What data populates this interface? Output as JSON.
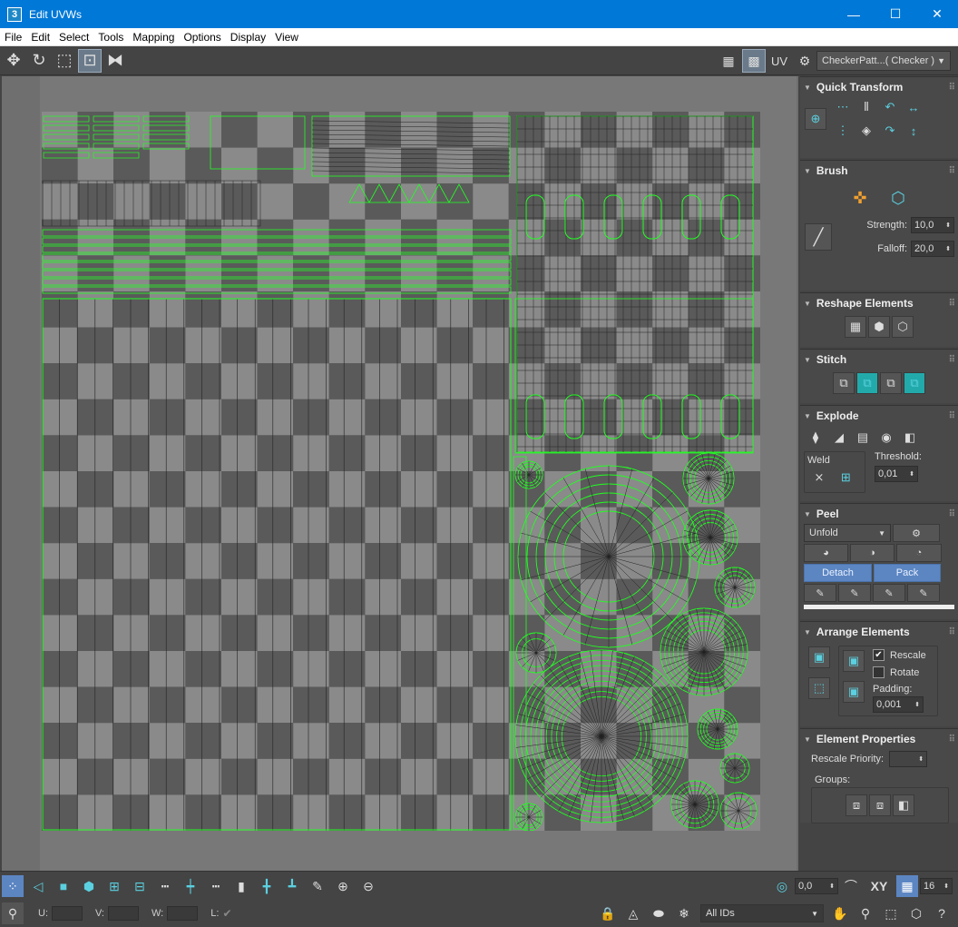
{
  "window": {
    "title": "Edit UVWs",
    "app_icon": "3",
    "minimize": "—",
    "maximize": "☐",
    "close": "✕"
  },
  "menu": [
    "File",
    "Edit",
    "Select",
    "Tools",
    "Mapping",
    "Options",
    "Display",
    "View"
  ],
  "toolbar": {
    "uv_label": "UV",
    "checker_dropdown": "CheckerPatt...( Checker )",
    "dropdown_arrow": "▼"
  },
  "panel": {
    "quick_transform": {
      "title": "Quick Transform"
    },
    "brush": {
      "title": "Brush",
      "strength_label": "Strength:",
      "strength_value": "10,0",
      "falloff_label": "Falloff:",
      "falloff_value": "20,0"
    },
    "reshape": {
      "title": "Reshape Elements"
    },
    "stitch": {
      "title": "Stitch"
    },
    "explode": {
      "title": "Explode",
      "weld_label": "Weld",
      "threshold_label": "Threshold:",
      "threshold_value": "0,01"
    },
    "peel": {
      "title": "Peel",
      "mode_value": "Unfold",
      "detach_label": "Detach",
      "pack_label": "Pack"
    },
    "arrange": {
      "title": "Arrange Elements",
      "rescale_label": "Rescale",
      "rescale_checked": true,
      "rotate_label": "Rotate",
      "rotate_checked": false,
      "padding_label": "Padding:",
      "padding_value": "0,001"
    },
    "element_props": {
      "title": "Element Properties",
      "rescale_priority_label": "Rescale Priority:",
      "groups_label": "Groups:"
    }
  },
  "bottom": {
    "angle_value": "0,0",
    "xy_label": "XY",
    "grid_value": "16",
    "u_label": "U:",
    "v_label": "V:",
    "w_label": "W:",
    "l_label": "L:",
    "ids_dropdown": "All IDs"
  },
  "colors": {
    "titlebar": "#0078d7",
    "accent": "#5bd0e0",
    "wire": "#22ff22",
    "button_blue": "#5c86c2"
  }
}
